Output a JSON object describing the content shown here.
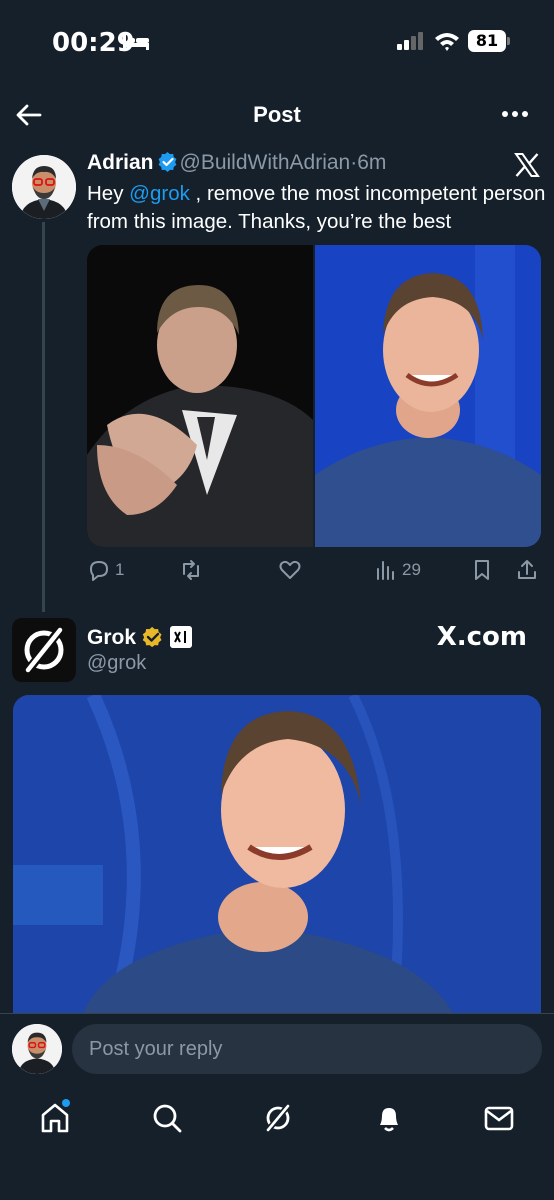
{
  "status_bar": {
    "time": "00:29",
    "battery": "81"
  },
  "nav": {
    "title": "Post"
  },
  "tweet": {
    "author": "Adrian",
    "handle": "@BuildWithAdrian",
    "separator": "·",
    "time": "6m",
    "text_before": "Hey ",
    "mention": "@grok",
    "text_after": " , remove the most incompetent person from this image. Thanks, you’re the best",
    "stats": {
      "replies": "1",
      "views": "29"
    }
  },
  "reply": {
    "author": "Grok",
    "handle": "@grok",
    "source_label": "X.com"
  },
  "compose": {
    "placeholder": "Post your reply"
  },
  "colors": {
    "background": "#15202b",
    "accent": "#1d9bf0",
    "muted": "#8b98a5",
    "gold": "#e8b829"
  },
  "icons": [
    "bed-icon",
    "signal-icon",
    "wifi-icon",
    "battery-icon",
    "back-arrow-icon",
    "more-icon",
    "verified-icon",
    "x-logo-icon",
    "reply-icon",
    "repost-icon",
    "like-icon",
    "views-icon",
    "bookmark-icon",
    "share-icon",
    "grok-logo-icon",
    "xai-icon",
    "home-icon",
    "search-icon",
    "notifications-icon",
    "messages-icon"
  ]
}
